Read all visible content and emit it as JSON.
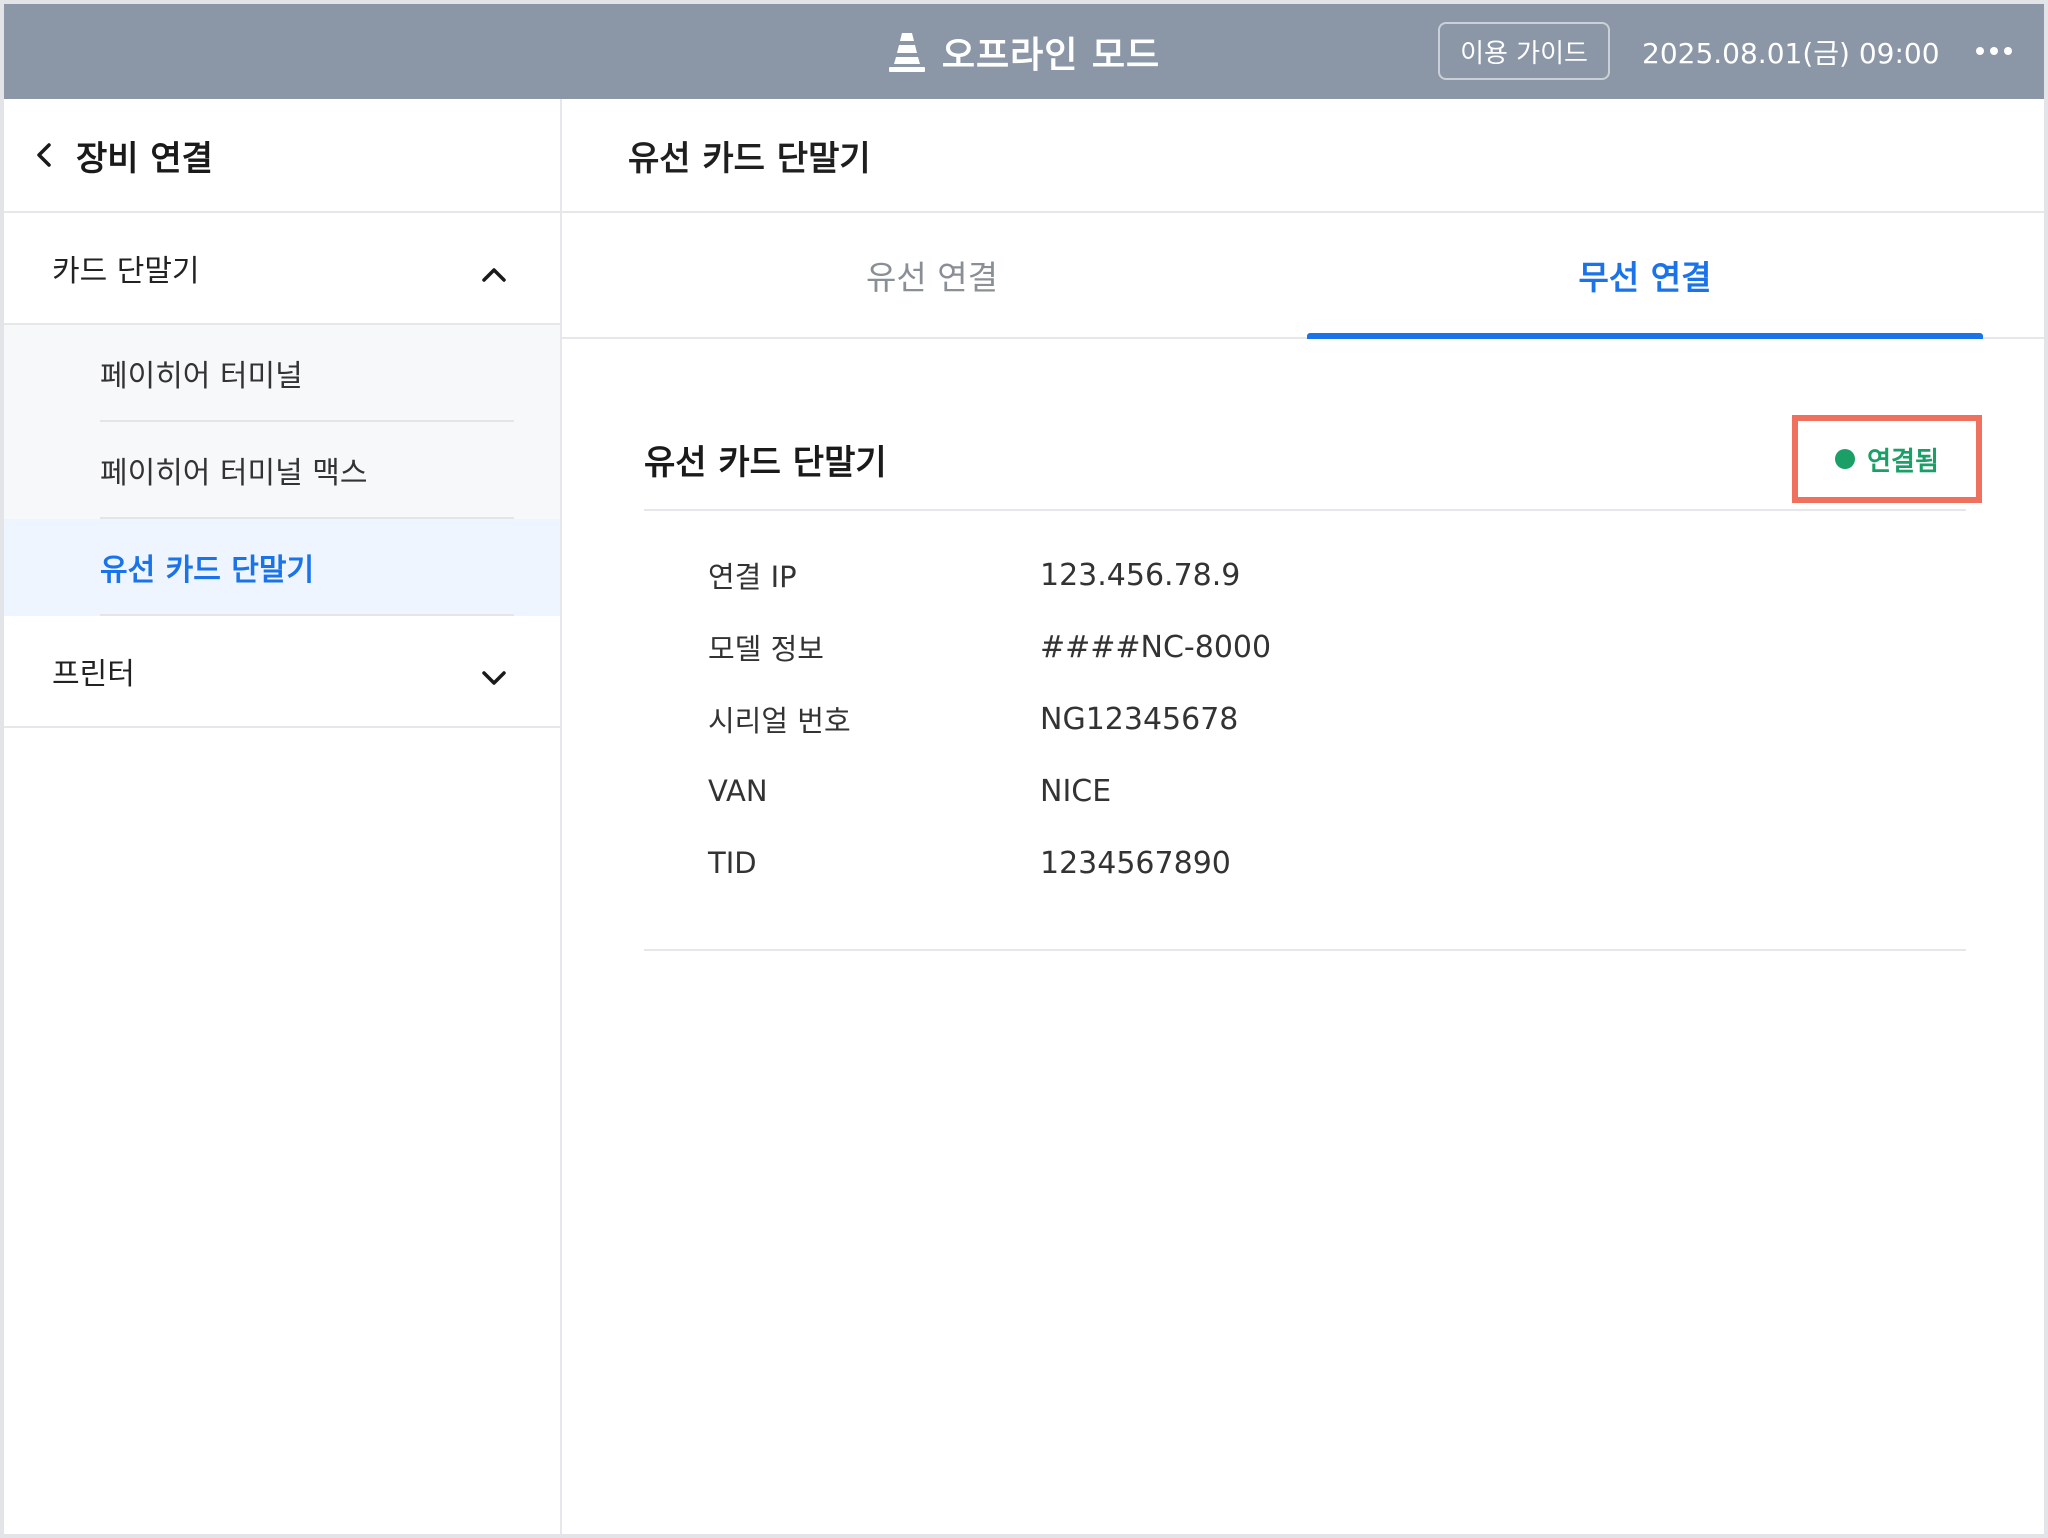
{
  "topbar": {
    "mode_label": "오프라인 모드",
    "guide_button": "이용 가이드",
    "datetime": "2025.08.01(금) 09:00",
    "background": "#8b97a6"
  },
  "sidebar": {
    "title": "장비 연결",
    "groups": [
      {
        "label": "카드 단말기",
        "expanded": true,
        "items": [
          {
            "label": "페이히어 터미널",
            "active": false
          },
          {
            "label": "페이히어 터미널 맥스",
            "active": false
          },
          {
            "label": "유선 카드 단말기",
            "active": true
          }
        ]
      },
      {
        "label": "프린터",
        "expanded": false,
        "items": []
      }
    ]
  },
  "main": {
    "title": "유선 카드 단말기",
    "tabs": [
      {
        "label": "유선 연결",
        "active": false
      },
      {
        "label": "무선 연결",
        "active": true
      }
    ],
    "device": {
      "name": "유선 카드 단말기",
      "status": "연결됨",
      "status_color": "#1aa067",
      "fields": [
        {
          "label": "연결 IP",
          "value": "123.456.78.9"
        },
        {
          "label": "모델 정보",
          "value": "####NC-8000"
        },
        {
          "label": "시리얼 번호",
          "value": "NG12345678"
        },
        {
          "label": "VAN",
          "value": "NICE"
        },
        {
          "label": "TID",
          "value": "1234567890"
        }
      ]
    }
  },
  "colors": {
    "accent": "#1a73e8",
    "highlight_box": "#f0705e"
  },
  "icons": [
    "traffic-cone-icon",
    "more-icon",
    "back-icon",
    "chevron-up-icon",
    "chevron-down-icon",
    "status-dot-icon"
  ]
}
